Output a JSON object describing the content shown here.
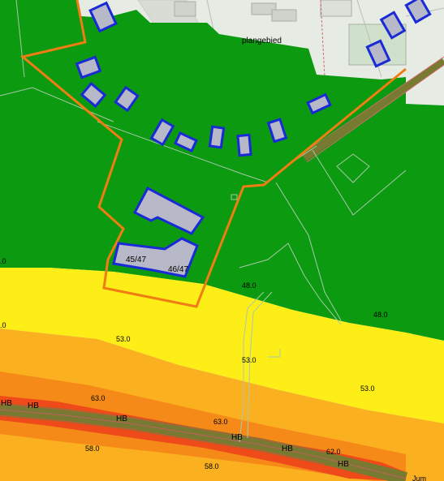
{
  "map": {
    "area_label": "plangebied",
    "building_labels": [
      "45/47",
      "46/47"
    ],
    "contour_labels": {
      "c1": "48.0",
      "c2": "48.0",
      "c3": "48.0",
      "c4": "53.0",
      "c5": "53.0",
      "c6": "53.0",
      "c7": "63.0",
      "c8": "63.0",
      "c9": "62.0",
      "c10": "58.0",
      "c11": "58.0",
      "c12": ".0",
      "c13": ".0"
    },
    "road_labels": [
      "HB",
      "HB",
      "HB",
      "HB",
      "HB",
      "HB"
    ],
    "edge_label": "Jum",
    "colors": {
      "zone_48": "#0b9a10",
      "zone_53": "#fdee17",
      "zone_58": "#fbb020",
      "zone_63": "#f58a18",
      "zone_68": "#ee4a1a",
      "road": "#777a30",
      "building_fill": "#b7b8c8",
      "building_stroke": "#1a2ad6",
      "plan_boundary": "#f07d13",
      "basemap": "#e6ebe4"
    }
  }
}
